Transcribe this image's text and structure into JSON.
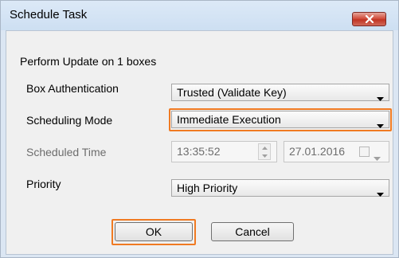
{
  "window": {
    "title": "Schedule Task"
  },
  "dialog": {
    "header": "Perform Update on 1 boxes",
    "fields": {
      "box_authentication": {
        "label": "Box Authentication",
        "value": "Trusted (Validate Key)"
      },
      "scheduling_mode": {
        "label": "Scheduling Mode",
        "value": "Immediate Execution"
      },
      "scheduled_time": {
        "label": "Scheduled Time",
        "time": "13:35:52",
        "date": "27.01.2016",
        "enabled": false
      },
      "priority": {
        "label": "Priority",
        "value": "High Priority"
      }
    },
    "buttons": {
      "ok": "OK",
      "cancel": "Cancel"
    }
  },
  "colors": {
    "focus_highlight": "#f07a22",
    "close_button": "#c13523",
    "disabled_text": "#6d6d6d"
  },
  "icons": [
    "close-icon",
    "dropdown-arrow-icon",
    "spin-up-icon",
    "spin-down-icon",
    "checkbox-icon"
  ]
}
